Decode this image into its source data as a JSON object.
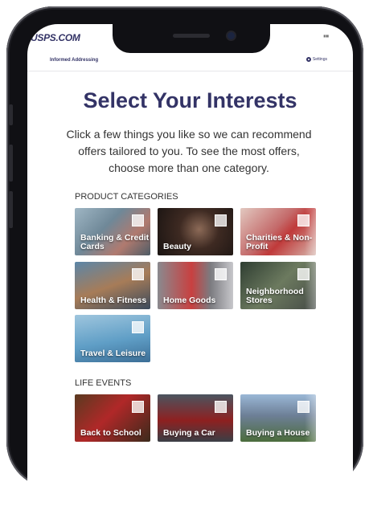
{
  "brand": "USPS.COM",
  "header": {
    "title": "Informed Addressing",
    "settings_label": "Settings"
  },
  "page_title": "Select Your Interests",
  "intro": "Click a few things you like so we can recommend offers tailored to you. To see the most offers, choose more than one category.",
  "product_categories": {
    "label": "PRODUCT CATEGORIES",
    "items": [
      {
        "label": "Banking & Credit Cards"
      },
      {
        "label": "Beauty"
      },
      {
        "label": "Charities & Non-Profit"
      },
      {
        "label": "Health & Fitness"
      },
      {
        "label": "Home Goods"
      },
      {
        "label": "Neighborhood Stores"
      },
      {
        "label": "Travel & Leisure"
      }
    ]
  },
  "life_events": {
    "label": "LIFE EVENTS",
    "items": [
      {
        "label": "Back to School"
      },
      {
        "label": "Buying a Car"
      },
      {
        "label": "Buying a House"
      }
    ]
  }
}
